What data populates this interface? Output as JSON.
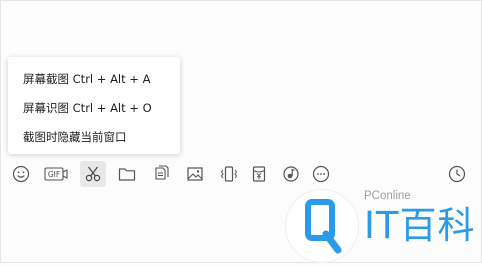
{
  "screenshot_menu": {
    "items": [
      {
        "label": "屏幕截图 Ctrl + Alt + A"
      },
      {
        "label": "屏幕识图 Ctrl + Alt + O"
      },
      {
        "label": "截图时隐藏当前窗口"
      }
    ]
  },
  "toolbar": {
    "icons": [
      "emoji-icon",
      "gif-icon",
      "scissors-icon",
      "folder-icon",
      "documents-icon",
      "image-icon",
      "shake-icon",
      "red-packet-icon",
      "music-icon",
      "more-icon",
      "history-clock-icon"
    ],
    "gif_text": "GIF"
  },
  "watermark": {
    "brand": "PConline",
    "name": "IT百科",
    "colors": {
      "accent": "#2b9be8",
      "gray": "#9aa0a6"
    }
  }
}
